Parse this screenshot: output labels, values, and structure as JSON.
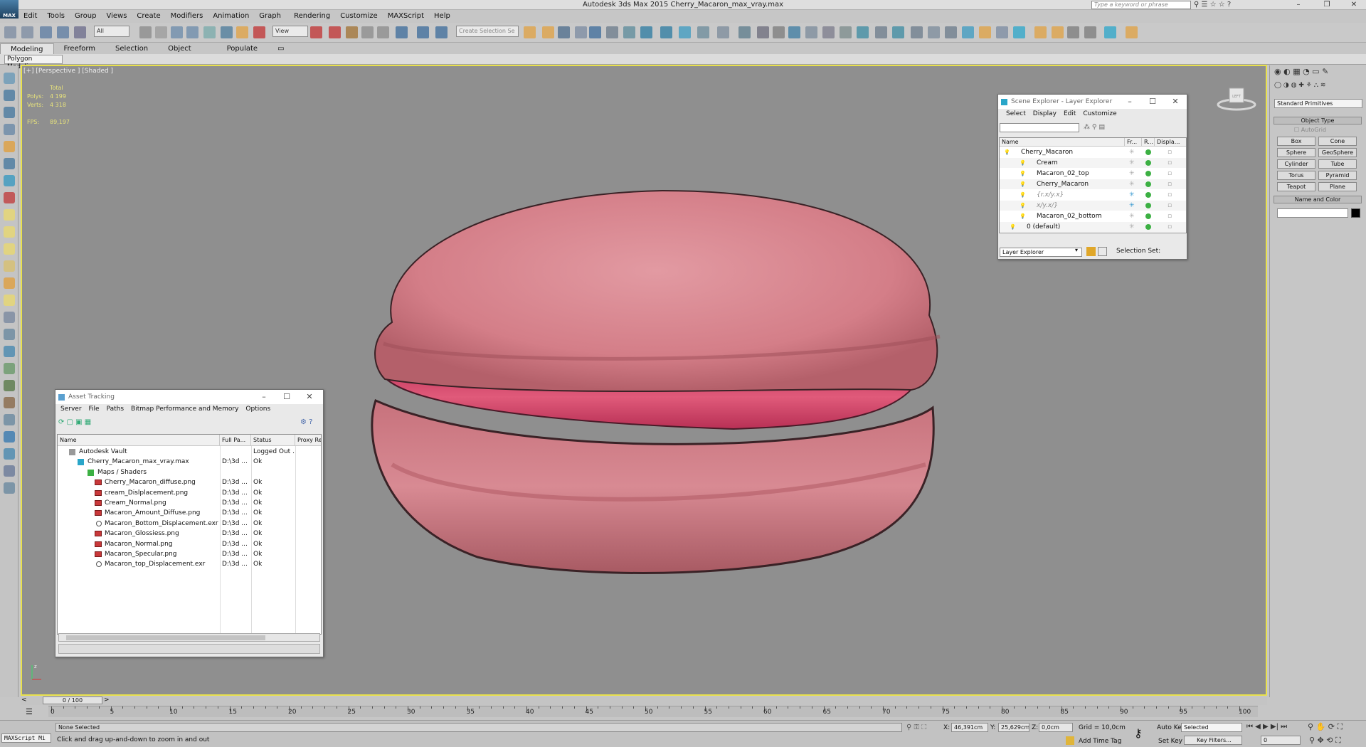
{
  "app": {
    "title": "Autodesk 3ds Max  2015    Cherry_Macaron_max_vray.max",
    "search_placeholder": "Type a keyword or phrase",
    "logo": "MAX"
  },
  "menu": [
    "Edit",
    "Tools",
    "Group",
    "Views",
    "Create",
    "Modifiers",
    "Animation",
    "Graph Editors",
    "Rendering",
    "Customize",
    "MAXScript",
    "Help"
  ],
  "toolbar": {
    "filter_value": "All",
    "ref_coord_value": "View",
    "selection_set_placeholder": "Create Selection Se"
  },
  "ribbon": {
    "tabs": [
      "Modeling",
      "Freeform",
      "Selection",
      "Object Paint",
      "Populate"
    ],
    "active_tab": "Modeling",
    "subpanel": "Polygon Modeling"
  },
  "viewport": {
    "label": "[+] [Perspective ] [Shaded ]",
    "stats": {
      "total_label": "Total",
      "polys_label": "Polys:",
      "polys_value": "4 199",
      "verts_label": "Verts:",
      "verts_value": "4 318",
      "fps_label": "FPS:",
      "fps_value": "89,197"
    },
    "navcube_label": "LEFT",
    "object": "Cherry_Macaron",
    "colors": {
      "shell": "#d8848f",
      "cream": "#e05a7a",
      "background": "#8f8f8f",
      "frame": "#e9e14c"
    }
  },
  "scene_explorer": {
    "title": "Scene Explorer - Layer Explorer",
    "menu": [
      "Select",
      "Display",
      "Edit",
      "Customize"
    ],
    "columns": [
      "Name",
      "Fr...",
      "R...",
      "Displa..."
    ],
    "rows": [
      {
        "name": "Cherry_Macaron",
        "type": "layer"
      },
      {
        "name": "Cream",
        "type": "object"
      },
      {
        "name": "Macaron_02_top",
        "type": "object"
      },
      {
        "name": "Cherry_Macaron",
        "type": "object"
      },
      {
        "name": "{r.x/y.x}",
        "type": "helper"
      },
      {
        "name": "x/y.x/}",
        "type": "helper"
      },
      {
        "name": "Macaron_02_bottom",
        "type": "object"
      },
      {
        "name": "0 (default)",
        "type": "layer"
      }
    ],
    "footer_combo": "Layer Explorer",
    "selection_set_label": "Selection Set:"
  },
  "asset_tracking": {
    "title": "Asset Tracking",
    "menu": [
      "Server",
      "File",
      "Paths",
      "Bitmap Performance and Memory",
      "Options"
    ],
    "columns": [
      "Name",
      "Full Pa...",
      "Status",
      "Proxy Re"
    ],
    "rows": [
      {
        "name": "Autodesk Vault",
        "path": "",
        "status": "Logged Out ...",
        "kind": "vault"
      },
      {
        "name": "Cherry_Macaron_max_vray.max",
        "path": "D:\\3d ...",
        "status": "Ok",
        "kind": "max"
      },
      {
        "name": "Maps / Shaders",
        "path": "",
        "status": "",
        "kind": "folder"
      },
      {
        "name": "Cherry_Macaron_diffuse.png",
        "path": "D:\\3d ...",
        "status": "Ok",
        "kind": "png"
      },
      {
        "name": "cream_Dislplacement.png",
        "path": "D:\\3d ...",
        "status": "Ok",
        "kind": "png"
      },
      {
        "name": "Cream_Normal.png",
        "path": "D:\\3d ...",
        "status": "Ok",
        "kind": "png"
      },
      {
        "name": "Macaron_Amount_Diffuse.png",
        "path": "D:\\3d ...",
        "status": "Ok",
        "kind": "png"
      },
      {
        "name": "Macaron_Bottom_Displacement.exr",
        "path": "D:\\3d ...",
        "status": "Ok",
        "kind": "exr"
      },
      {
        "name": "Macaron_Glossiess.png",
        "path": "D:\\3d ...",
        "status": "Ok",
        "kind": "png"
      },
      {
        "name": "Macaron_Normal.png",
        "path": "D:\\3d ...",
        "status": "Ok",
        "kind": "png"
      },
      {
        "name": "Macaron_Specular.png",
        "path": "D:\\3d ...",
        "status": "Ok",
        "kind": "png"
      },
      {
        "name": "Macaron_top_Displacement.exr",
        "path": "D:\\3d ...",
        "status": "Ok",
        "kind": "exr"
      }
    ]
  },
  "command_panel": {
    "category": "Standard Primitives",
    "object_type_label": "Object Type",
    "autogrid_label": "AutoGrid",
    "buttons": [
      "Box",
      "Cone",
      "Sphere",
      "GeoSphere",
      "Cylinder",
      "Tube",
      "Torus",
      "Pyramid",
      "Teapot",
      "Plane"
    ],
    "name_color_label": "Name and Color",
    "name_value": ""
  },
  "timeline": {
    "slider_label": "0 / 100",
    "ticks": [
      0,
      5,
      10,
      15,
      20,
      25,
      30,
      35,
      40,
      45,
      50,
      55,
      60,
      65,
      70,
      75,
      80,
      85,
      90,
      95,
      100
    ]
  },
  "status": {
    "listener": "MAXScript Mi",
    "selection": "None Selected",
    "prompt": "Click and drag up-and-down to zoom in and out",
    "x_label": "X:",
    "x_value": "46,391cm",
    "y_label": "Y:",
    "y_value": "25,629cm",
    "z_label": "Z:",
    "z_value": "0,0cm",
    "grid": "Grid = 10,0cm",
    "add_time_tag": "Add Time Tag",
    "auto_key": "Auto Key",
    "set_key": "Set Key",
    "key_mode_value": "Selected",
    "key_filters": "Key Filters...",
    "frame_value": "0"
  }
}
